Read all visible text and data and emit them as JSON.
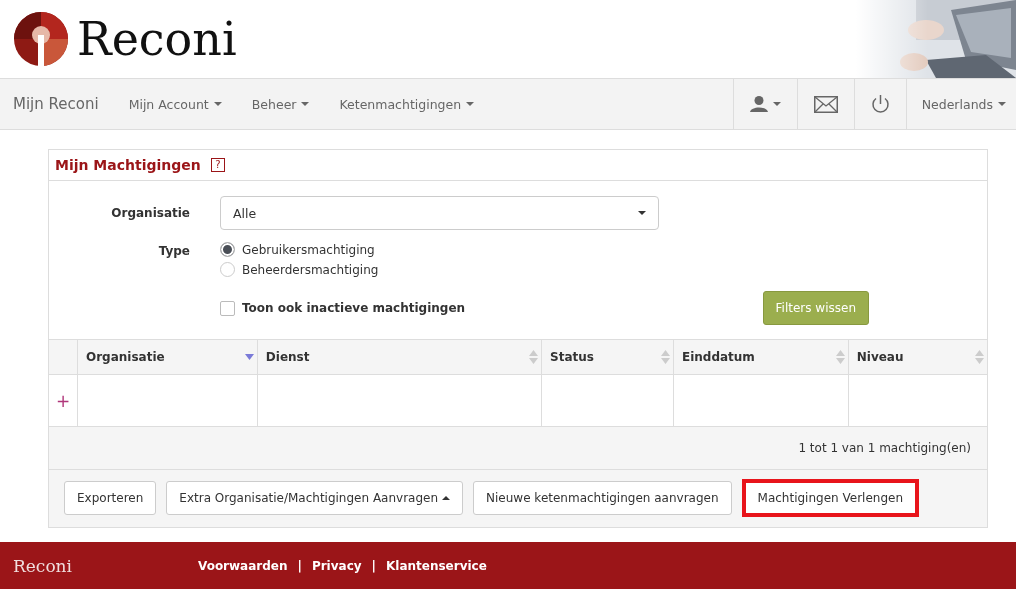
{
  "header": {
    "logo_text": "Reconi"
  },
  "nav": {
    "brand": "Mijn Reconi",
    "menus": [
      {
        "label": "Mijn Account"
      },
      {
        "label": "Beheer"
      },
      {
        "label": "Ketenmachtigingen"
      }
    ],
    "language": "Nederlands"
  },
  "panel": {
    "title": "Mijn Machtigingen",
    "help": "?",
    "filters": {
      "organisatie_label": "Organisatie",
      "organisatie_value": "Alle",
      "type_label": "Type",
      "types": [
        {
          "label": "Gebruikersmachtiging",
          "selected": true
        },
        {
          "label": "Beheerdersmachtiging",
          "selected": false
        }
      ],
      "inactive": {
        "label": "Toon ook inactieve machtigingen",
        "checked": false
      },
      "clear_button": "Filters wissen"
    },
    "table": {
      "expand": "+",
      "columns": [
        {
          "label": "Organisatie",
          "sorted": true
        },
        {
          "label": "Dienst",
          "sorted": false
        },
        {
          "label": "Status",
          "sorted": false
        },
        {
          "label": "Einddatum",
          "sorted": false
        },
        {
          "label": "Niveau",
          "sorted": false
        }
      ]
    },
    "pagination": "1 tot 1 van 1 machtiging(en)",
    "buttons": [
      {
        "label": "Exporteren",
        "dropup": false,
        "highlighted": false
      },
      {
        "label": "Extra Organisatie/Machtigingen Aanvragen",
        "dropup": true,
        "highlighted": false
      },
      {
        "label": "Nieuwe ketenmachtigingen aanvragen",
        "dropup": false,
        "highlighted": false
      },
      {
        "label": "Machtigingen Verlengen",
        "dropup": false,
        "highlighted": true
      }
    ]
  },
  "footer": {
    "brand": "Reconi",
    "separator": "|",
    "links": [
      "Voorwaarden",
      "Privacy",
      "Klantenservice"
    ]
  }
}
